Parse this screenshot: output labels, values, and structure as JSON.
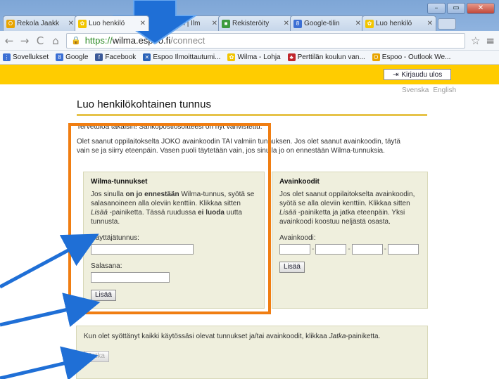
{
  "browser": {
    "tabs": [
      {
        "label": "Rekola Jaakk",
        "active": false,
        "fav_color": "#e8a400",
        "fav_glyph": "O"
      },
      {
        "label": "Luo henkilö",
        "active": true,
        "fav_color": "#f2c500",
        "fav_glyph": "✿"
      },
      {
        "label": "ospuu.fi | Ilm",
        "active": false,
        "fav_color": "#f2c500",
        "fav_glyph": "✿"
      },
      {
        "label": "Rekisteröity",
        "active": false,
        "fav_color": "#3d9a3d",
        "fav_glyph": "■"
      },
      {
        "label": "Google-tilin",
        "active": false,
        "fav_color": "#3b6fd4",
        "fav_glyph": "8"
      },
      {
        "label": "Luo henkilö",
        "active": false,
        "fav_color": "#f2c500",
        "fav_glyph": "✿"
      }
    ],
    "url_scheme": "https://",
    "url_host": "wilma.espoo.fi",
    "url_path": "/connect",
    "bookmarks": [
      {
        "label": "Sovellukset",
        "fav_color": "#3b6fd4",
        "fav_glyph": "⋮"
      },
      {
        "label": "Google",
        "fav_color": "#3b6fd4",
        "fav_glyph": "8"
      },
      {
        "label": "Facebook",
        "fav_color": "#3b5998",
        "fav_glyph": "f"
      },
      {
        "label": "Espoo Ilmoittautumi...",
        "fav_color": "#2a62b8",
        "fav_glyph": "✕"
      },
      {
        "label": "Wilma - Lohja",
        "fav_color": "#f2c500",
        "fav_glyph": "✿"
      },
      {
        "label": "Perttilän koulun van...",
        "fav_color": "#c0262d",
        "fav_glyph": "♣"
      },
      {
        "label": "Espoo - Outlook We...",
        "fav_color": "#e8a400",
        "fav_glyph": "O"
      }
    ]
  },
  "page": {
    "logout_label": "Kirjaudu ulos",
    "lang_sv": "Svenska",
    "lang_en": "English",
    "title": "Luo henkilökohtainen tunnus",
    "welcome": "Tervetuloa takaisin! Sähköpostiosoitteesi on nyt vahvistettu.",
    "intro": "Olet saanut oppilaitokselta JOKO avainkoodin TAI valmiin tunnuksen. Jos olet saanut avainkoodin, täytä vain se ja siirry eteenpäin. Vasen puoli täytetään vain, jos sinulla jo on ennestään Wilma-tunnuksia.",
    "wilma_box": {
      "title": "Wilma-tunnukset",
      "text_1": "Jos sinulla ",
      "text_bold": "on jo ennestään",
      "text_2": " Wilma-tunnus, syötä se salasanoineen alla oleviin kenttiin. Klikkaa sitten ",
      "text_italic": "Lisää",
      "text_3": " -painiketta. Tässä ruudussa ",
      "text_bold2": "ei luoda",
      "text_4": " uutta tunnusta.",
      "username_label": "Käyttäjätunnus:",
      "password_label": "Salasana:",
      "add_label": "Lisää"
    },
    "key_box": {
      "title": "Avainkoodit",
      "text_1": "Jos olet saanut oppilaitokselta avainkoodin, syötä se alla oleviin kenttiin. Klikkaa sitten ",
      "text_italic": "Lisää",
      "text_2": " -painiketta ja jatka eteenpäin. Yksi avainkoodi koostuu neljästä osasta.",
      "code_label": "Avainkoodi:",
      "add_label": "Lisää"
    },
    "bottom_box": {
      "text_1": "Kun olet syöttänyt kaikki käytössäsi olevat tunnukset ja/tai avainkoodit, klikkaa ",
      "text_italic": "Jatka",
      "text_2": "-painiketta.",
      "continue_label": "Jatka"
    }
  },
  "colors": {
    "accent_yellow": "#ffcc00",
    "highlight_orange": "#f07e12",
    "arrow_blue": "#1f6fd6"
  }
}
